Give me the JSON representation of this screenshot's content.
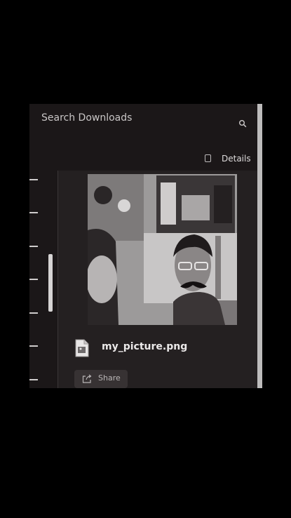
{
  "header": {
    "search_placeholder": "Search Downloads",
    "search_icon": "search-icon",
    "details_label": "Details",
    "details_checked": false
  },
  "download": {
    "file_name": "my_picture.png",
    "file_icon": "image-file-icon",
    "preview_icon": "photo-preview",
    "share_label": "Share",
    "share_icon": "share-icon"
  },
  "colors": {
    "background": "#1b1718",
    "panel": "#242021",
    "text": "#c9c6c6",
    "button": "#373233"
  }
}
